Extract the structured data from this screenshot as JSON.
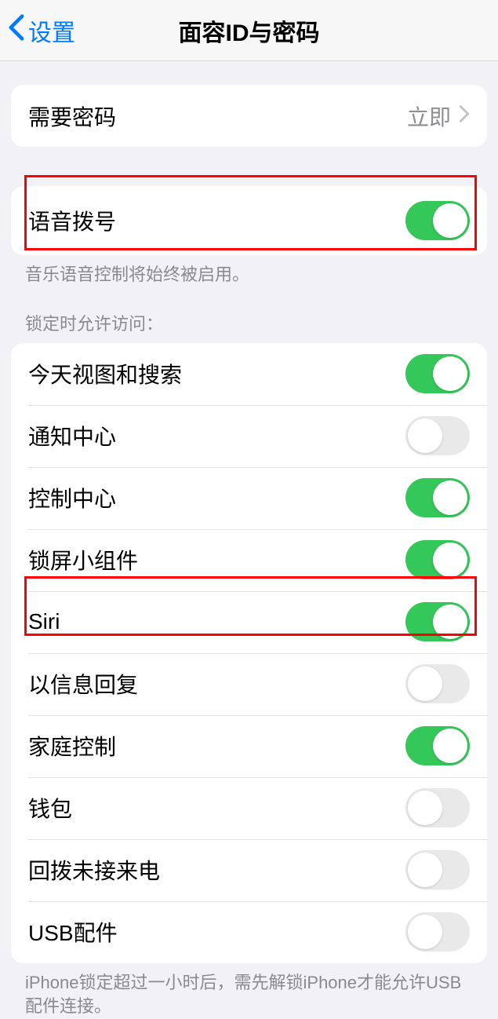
{
  "header": {
    "back_label": "设置",
    "title": "面容ID与密码"
  },
  "group1": {
    "require_passcode": {
      "label": "需要密码",
      "value": "立即"
    }
  },
  "group2": {
    "voice_dial": {
      "label": "语音拨号",
      "on": true
    },
    "footer": "音乐语音控制将始终被启用。"
  },
  "group3_header": "锁定时允许访问：",
  "group3": {
    "items": [
      {
        "label": "今天视图和搜索",
        "on": true
      },
      {
        "label": "通知中心",
        "on": false
      },
      {
        "label": "控制中心",
        "on": true
      },
      {
        "label": "锁屏小组件",
        "on": true
      },
      {
        "label": "Siri",
        "on": true
      },
      {
        "label": "以信息回复",
        "on": false
      },
      {
        "label": "家庭控制",
        "on": true
      },
      {
        "label": "钱包",
        "on": false
      },
      {
        "label": "回拨未接来电",
        "on": false
      },
      {
        "label": "USB配件",
        "on": false
      }
    ],
    "footer": "iPhone锁定超过一小时后，需先解锁iPhone才能允许USB配件连接。"
  }
}
